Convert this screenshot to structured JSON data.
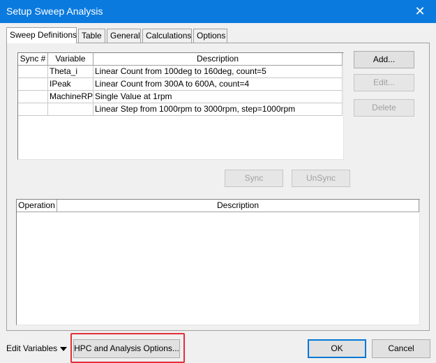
{
  "window": {
    "title": "Setup Sweep Analysis",
    "close_glyph": "✕"
  },
  "tabs": [
    {
      "label": "Sweep Definitions"
    },
    {
      "label": "Table"
    },
    {
      "label": "General"
    },
    {
      "label": "Calculations"
    },
    {
      "label": "Options"
    }
  ],
  "sweep_table": {
    "headers": [
      "Sync #",
      "Variable",
      "Description"
    ],
    "rows": [
      {
        "sync": "",
        "variable": "Theta_i",
        "description": "Linear Count from 100deg to 160deg, count=5"
      },
      {
        "sync": "",
        "variable": "IPeak",
        "description": "Linear Count from 300A to 600A, count=4"
      },
      {
        "sync": "",
        "variable": "MachineRPM",
        "description": "Single Value at 1rpm"
      },
      {
        "sync": "",
        "variable": "",
        "description": "Linear Step from 1000rpm to 3000rpm, step=1000rpm"
      }
    ]
  },
  "side_buttons": {
    "add": "Add...",
    "edit": "Edit...",
    "delete": "Delete"
  },
  "sync_buttons": {
    "sync": "Sync",
    "unsync": "UnSync"
  },
  "operation_table": {
    "headers": [
      "Operation",
      "Description"
    ]
  },
  "footer": {
    "edit_variables": "Edit Variables",
    "hpc": "HPC and Analysis Options...",
    "ok": "OK",
    "cancel": "Cancel"
  }
}
